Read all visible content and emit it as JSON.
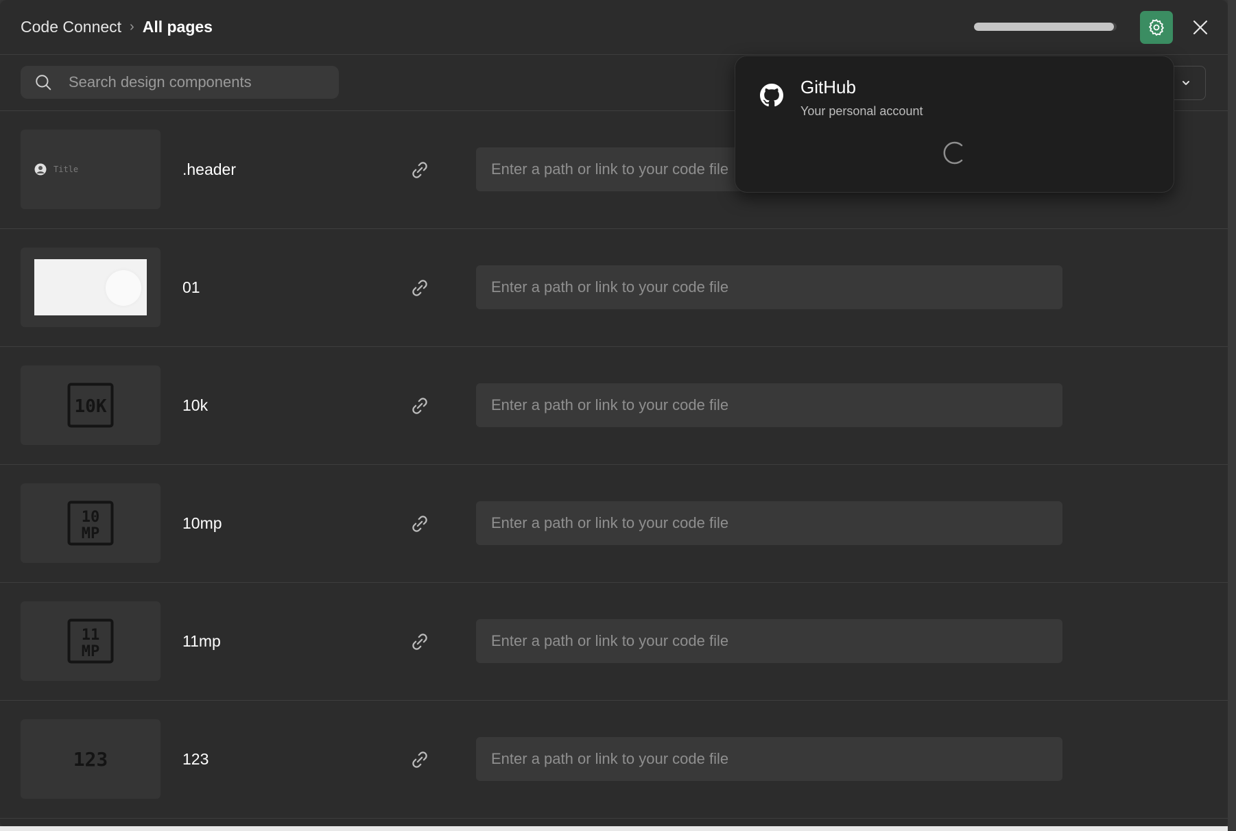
{
  "breadcrumb": {
    "root": "Code Connect",
    "separator": "›",
    "current": "All pages"
  },
  "toolbar": {
    "progress_fraction": 0.98,
    "settings_icon": "gear-icon",
    "settings_color": "#3b8d62",
    "close_icon": "close-icon"
  },
  "search": {
    "placeholder": "Search design components",
    "value": ""
  },
  "filter": {
    "icon": "chevron-down-icon"
  },
  "github_popover": {
    "title": "GitHub",
    "subtitle": "Your personal account",
    "icon": "github-icon",
    "status": "loading"
  },
  "components": [
    {
      "name": ".header",
      "thumb_text": "Title",
      "placeholder": "Enter a path or link to your code file",
      "value": ""
    },
    {
      "name": "01",
      "placeholder": "Enter a path or link to your code file",
      "value": ""
    },
    {
      "name": "10k",
      "thumb_glyph": "10K",
      "placeholder": "Enter a path or link to your code file",
      "value": ""
    },
    {
      "name": "10mp",
      "thumb_glyph": "10 MP",
      "placeholder": "Enter a path or link to your code file",
      "value": ""
    },
    {
      "name": "11mp",
      "thumb_glyph": "11 MP",
      "placeholder": "Enter a path or link to your code file",
      "value": ""
    },
    {
      "name": "123",
      "thumb_glyph": "123",
      "placeholder": "Enter a path or link to your code file",
      "value": ""
    }
  ]
}
